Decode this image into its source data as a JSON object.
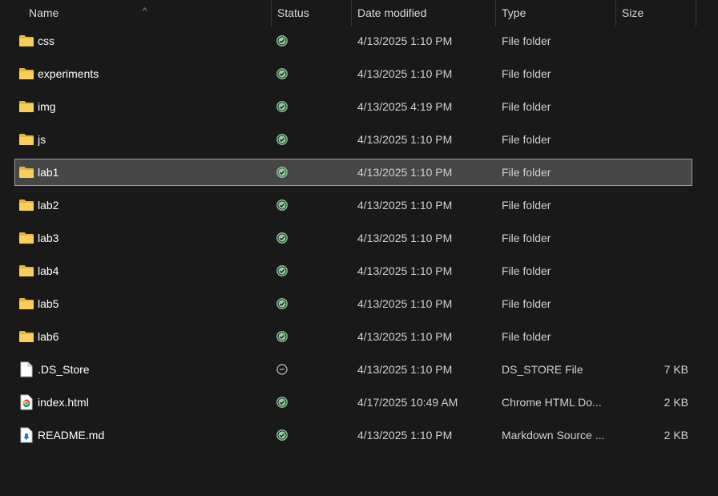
{
  "columns": {
    "name": "Name",
    "status": "Status",
    "date": "Date modified",
    "type": "Type",
    "size": "Size"
  },
  "colors": {
    "background": "#191919",
    "selected_row": "#464646",
    "folder": "#f2c94c",
    "status_ok": "#8fd19e"
  },
  "files": [
    {
      "name": "css",
      "status": "available-icon",
      "date": "4/13/2025 1:10 PM",
      "type": "File folder",
      "size": "",
      "icon": "folder-icon",
      "selected": false
    },
    {
      "name": "experiments",
      "status": "available-icon",
      "date": "4/13/2025 1:10 PM",
      "type": "File folder",
      "size": "",
      "icon": "folder-icon",
      "selected": false
    },
    {
      "name": "img",
      "status": "available-icon",
      "date": "4/13/2025 4:19 PM",
      "type": "File folder",
      "size": "",
      "icon": "folder-icon",
      "selected": false
    },
    {
      "name": "js",
      "status": "available-icon",
      "date": "4/13/2025 1:10 PM",
      "type": "File folder",
      "size": "",
      "icon": "folder-icon",
      "selected": false
    },
    {
      "name": "lab1",
      "status": "available-icon",
      "date": "4/13/2025 1:10 PM",
      "type": "File folder",
      "size": "",
      "icon": "folder-icon",
      "selected": true
    },
    {
      "name": "lab2",
      "status": "available-icon",
      "date": "4/13/2025 1:10 PM",
      "type": "File folder",
      "size": "",
      "icon": "folder-icon",
      "selected": false
    },
    {
      "name": "lab3",
      "status": "available-icon",
      "date": "4/13/2025 1:10 PM",
      "type": "File folder",
      "size": "",
      "icon": "folder-icon",
      "selected": false
    },
    {
      "name": "lab4",
      "status": "available-icon",
      "date": "4/13/2025 1:10 PM",
      "type": "File folder",
      "size": "",
      "icon": "folder-icon",
      "selected": false
    },
    {
      "name": "lab5",
      "status": "available-icon",
      "date": "4/13/2025 1:10 PM",
      "type": "File folder",
      "size": "",
      "icon": "folder-icon",
      "selected": false
    },
    {
      "name": "lab6",
      "status": "available-icon",
      "date": "4/13/2025 1:10 PM",
      "type": "File folder",
      "size": "",
      "icon": "folder-icon",
      "selected": false
    },
    {
      "name": ".DS_Store",
      "status": "excluded-icon",
      "date": "4/13/2025 1:10 PM",
      "type": "DS_STORE File",
      "size": "7 KB",
      "icon": "file-icon",
      "selected": false
    },
    {
      "name": "index.html",
      "status": "available-icon",
      "date": "4/17/2025 10:49 AM",
      "type": "Chrome HTML Do...",
      "size": "2 KB",
      "icon": "chrome-html-icon",
      "selected": false
    },
    {
      "name": "README.md",
      "status": "available-icon",
      "date": "4/13/2025 1:10 PM",
      "type": "Markdown Source ...",
      "size": "2 KB",
      "icon": "markdown-file-icon",
      "selected": false
    }
  ]
}
